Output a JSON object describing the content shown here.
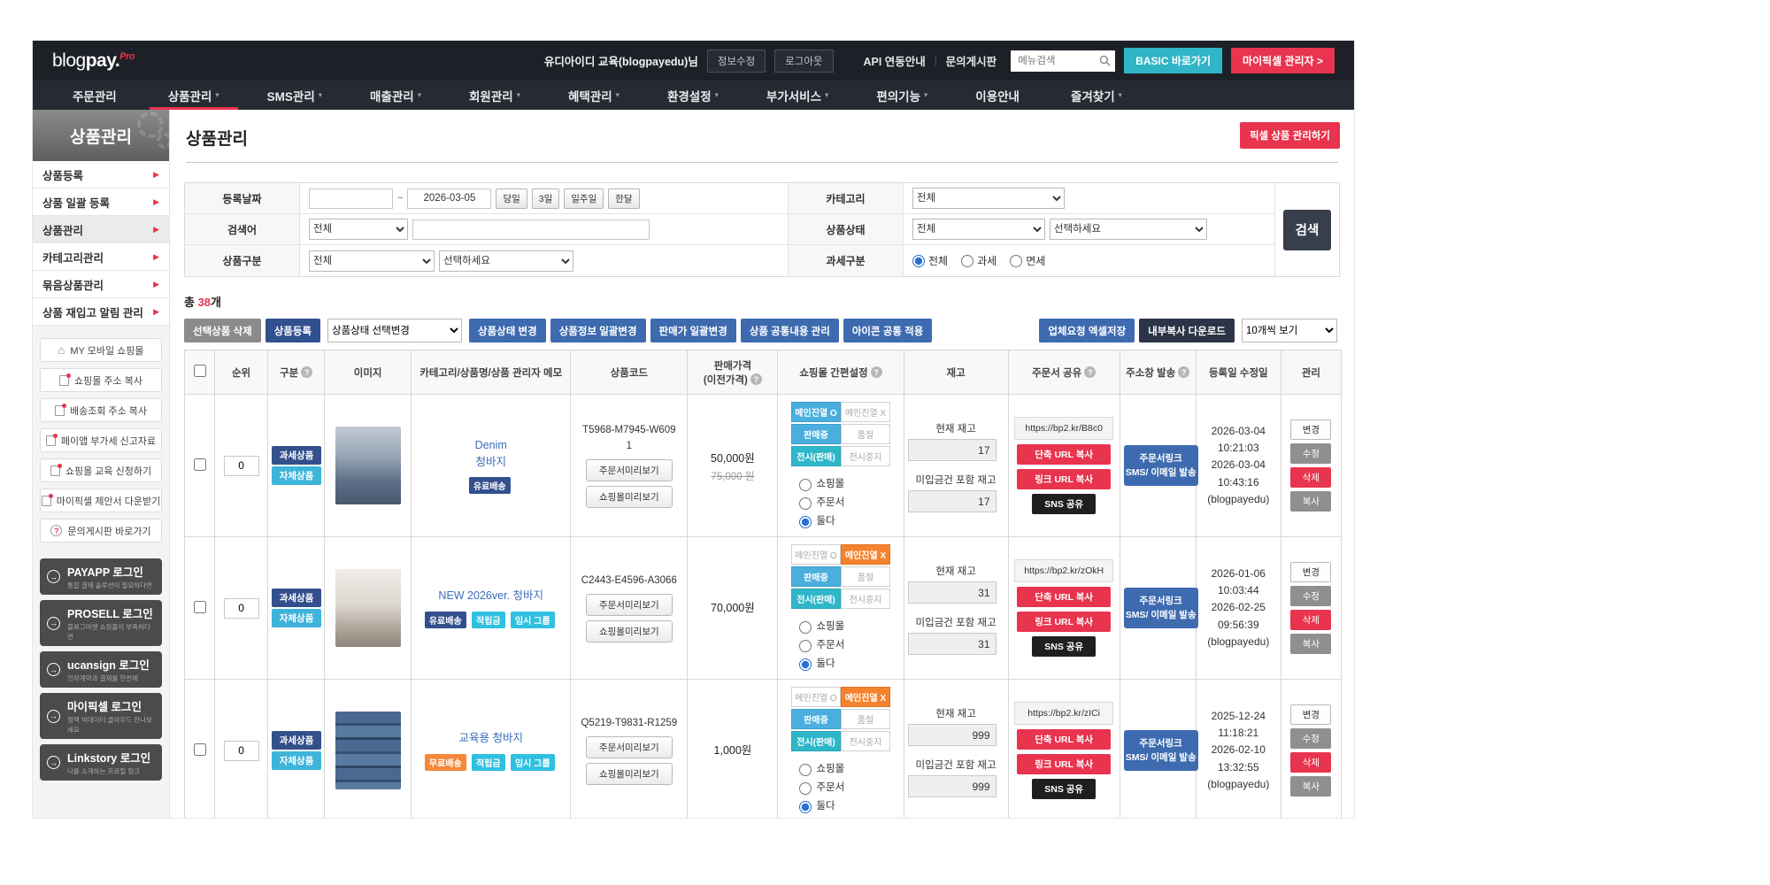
{
  "colors": {
    "accent_red": "#e8344e",
    "blue": "#3e6bb0",
    "navy": "#33508c",
    "cyan": "#2fc0e0",
    "teal": "#2fb6c9",
    "orange": "#f5822d",
    "basic_teal": "#2fb5c6"
  },
  "topbar": {
    "logo_text": "blog",
    "logo_text2": "pay.",
    "logo_pro": "Pro",
    "user": "유디아이디 교육(blogpayedu)님",
    "edit_info": "정보수정",
    "logout": "로그아웃",
    "api_link": "API 연동안내",
    "board_link": "문의게시판",
    "search_placeholder": "메뉴검색",
    "basic_button": "BASIC 바로가기",
    "pixel_admin_button": "마이픽셀 관리자 >"
  },
  "nav": {
    "items": [
      {
        "label": "주문관리",
        "caret": ""
      },
      {
        "label": "상품관리",
        "caret": "▾"
      },
      {
        "label": "SMS관리",
        "caret": "▾"
      },
      {
        "label": "매출관리",
        "caret": "▾"
      },
      {
        "label": "회원관리",
        "caret": "▾"
      },
      {
        "label": "혜택관리",
        "caret": "▾"
      },
      {
        "label": "환경설정",
        "caret": "▾"
      },
      {
        "label": "부가서비스",
        "caret": "▾"
      },
      {
        "label": "편의기능",
        "caret": "▾"
      },
      {
        "label": "이용안내",
        "caret": ""
      },
      {
        "label": "즐겨찾기",
        "caret": "▾"
      }
    ]
  },
  "sidebar": {
    "title": "상품관리",
    "menu": [
      "상품등록",
      "상품 일괄 등록",
      "상품관리",
      "카테고리관리",
      "묶음상품관리",
      "상품 재입고 알림 관리"
    ],
    "quick_links": [
      "MY 모바일 쇼핑몰",
      "쇼핑몰 주소 복사",
      "배송조회 주소 복사",
      "페이앱 부가세 신고자료",
      "쇼핑몰 교육 신청하기",
      "마이픽셀 제안서 다운받기",
      "문의게시판 바로가기"
    ],
    "logins": [
      {
        "label": "PAYAPP 로그인",
        "sub": "통합 결제 솔루션이 필요하다면"
      },
      {
        "label": "PROSELL 로그인",
        "sub": "블로그마켓 쇼핑몰이 부족하다면"
      },
      {
        "label": "ucansign 로그인",
        "sub": "전자계약과 결제를 한번에"
      },
      {
        "label": "마이픽셀 로그인",
        "sub": "정책 빅데이터 클라우드 만나보세요"
      },
      {
        "label": "Linkstory 로그인",
        "sub": "나를 소개하는 프로필 링크"
      }
    ]
  },
  "page": {
    "title": "상품관리",
    "pixel_manage_button": "픽셀 상품 관리하기"
  },
  "filter": {
    "reg_date_label": "등록날짜",
    "date_from": "",
    "date_to": "2026-03-05",
    "date_quick": [
      "당일",
      "3일",
      "일주일",
      "한달"
    ],
    "category_label": "카테고리",
    "category_value": "전체",
    "keyword_label": "검색어",
    "keyword_type": "전체",
    "keyword_value": "",
    "status_label": "상품상태",
    "status_value": "전체",
    "status_value2": "선택하세요",
    "type_label": "상품구분",
    "type_value": "전체",
    "type_value2": "선택하세요",
    "tax_label": "과세구분",
    "tax_options": [
      "전체",
      "과세",
      "면세"
    ],
    "search_button": "검색"
  },
  "list": {
    "total_prefix": "총 ",
    "total_count": "38",
    "total_suffix": "개",
    "delete_button": "선택상품 삭제",
    "register_button": "상품등록",
    "status_select": "상품상태 선택변경",
    "bulk_buttons": [
      "상품상태 변경",
      "상품정보 일괄변경",
      "판매가 일괄변경",
      "상품 공통내용 관리",
      "아이콘 공통 적용"
    ],
    "excel_button": "업체요청 엑셀저장",
    "copy_download_button": "내부복사 다운로드",
    "per_page": "10개씩 보기"
  },
  "table": {
    "h_rank": "순위",
    "h_type": "구분",
    "h_image": "이미지",
    "h_name": "카테고리/상품명/상품 관리자 메모",
    "h_code": "상품코드",
    "h_price": "판매가격",
    "h_price_sub": "(이전가격)",
    "h_quick": "쇼핑몰 간편설정",
    "h_stock": "재고",
    "h_share": "주문서 공유",
    "h_send": "주소창 발송",
    "h_date": "등록일 수정일",
    "h_manage": "관리",
    "quick_labels": {
      "main_o": "메인진열 O",
      "main_x": "메인진열 X",
      "sell": "판매중",
      "soldout": "품절",
      "show": "전시(판매)",
      "stop": "전시중지"
    },
    "radio_labels": [
      "쇼핑몰",
      "주문서",
      "둘다"
    ],
    "stock_now_label": "현재 재고",
    "stock_incl_label": "미입금건 포함 재고",
    "preview_order": "주문서미리보기",
    "preview_shop": "쇼핑몰미리보기",
    "share_buttons": [
      "단축 URL 복사",
      "링크 URL 복사",
      "SNS 공유"
    ],
    "send_line1": "주문서링크",
    "send_line2": "SMS/ 이메일 발송",
    "manage_buttons": [
      "변경",
      "수정",
      "삭제",
      "복사"
    ]
  },
  "rows": [
    {
      "rank": "0",
      "type_badge1": "과세상품",
      "type_badge2": "자체상품",
      "img_cls": "photo p1",
      "name1": "Denim",
      "name2": "청바지",
      "badges": [
        {
          "label": "유료배송",
          "cls": "nb navy"
        }
      ],
      "code": "T5968-M7945-W6091",
      "price": "50,000원",
      "old_price": "75,000 원",
      "quick": {
        "mo": "qb on-blue",
        "mx": "qb",
        "sell": "qb on-blue",
        "soldout": "qb",
        "show": "qb on-teal",
        "stop": "qb"
      },
      "stock_now": "17",
      "stock_incl": "17",
      "url": "https://bp2.kr/B8c0",
      "reg": "2026-03-04 10:21:03",
      "mod": "2026-03-04 10:43:16",
      "by": "(blogpayedu)"
    },
    {
      "rank": "0",
      "type_badge1": "과세상품",
      "type_badge2": "자체상품",
      "img_cls": "photo p2",
      "name1": "NEW 2026ver. 청바지",
      "badges": [
        {
          "label": "유료배송",
          "cls": "nb navy"
        },
        {
          "label": "적립금",
          "cls": "nb cyan"
        },
        {
          "label": "임시 그룹",
          "cls": "nb cyan"
        }
      ],
      "code": "C2443-E4596-A3066",
      "price": "70,000원",
      "old_price": "",
      "quick": {
        "mo": "qb",
        "mx": "qb on-orange",
        "sell": "qb on-blue",
        "soldout": "qb",
        "show": "qb on-teal",
        "stop": "qb"
      },
      "stock_now": "31",
      "stock_incl": "31",
      "url": "https://bp2.kr/zOkH",
      "reg": "2026-01-06 10:03:44",
      "mod": "2026-02-25 09:56:39",
      "by": "(blogpayedu)"
    },
    {
      "rank": "0",
      "type_badge1": "과세상품",
      "type_badge2": "자체상품",
      "img_cls": "photo p3",
      "name1": "교육용 청바지",
      "badges": [
        {
          "label": "무료배송",
          "cls": "nb orange"
        },
        {
          "label": "적립금",
          "cls": "nb cyan"
        },
        {
          "label": "임시 그룹",
          "cls": "nb cyan"
        }
      ],
      "code": "Q5219-T9831-R1259",
      "price": "1,000원",
      "old_price": "",
      "quick": {
        "mo": "qb",
        "mx": "qb on-orange",
        "sell": "qb on-blue",
        "soldout": "qb",
        "show": "qb on-teal",
        "stop": "qb"
      },
      "stock_now": "999",
      "stock_incl": "999",
      "url": "https://bp2.kr/zICi",
      "reg": "2025-12-24 11:18:21",
      "mod": "2026-02-10 13:32:55",
      "by": "(blogpayedu)"
    }
  ]
}
